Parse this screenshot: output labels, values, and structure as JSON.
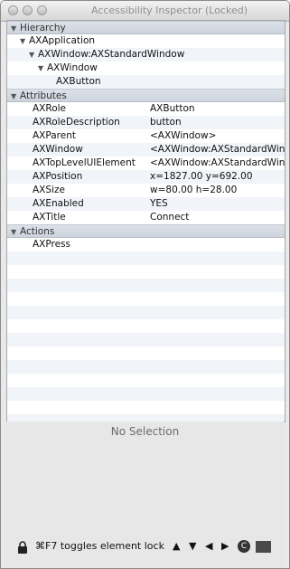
{
  "window": {
    "title": "Accessibility Inspector (Locked)"
  },
  "sections": {
    "hierarchy": "Hierarchy",
    "attributes": "Attributes",
    "actions": "Actions"
  },
  "hierarchy": [
    {
      "label": "AXApplication"
    },
    {
      "label": "AXWindow:AXStandardWindow"
    },
    {
      "label": "AXWindow"
    },
    {
      "label": "AXButton"
    }
  ],
  "attributes": [
    {
      "key": "AXRole",
      "value": "AXButton"
    },
    {
      "key": "AXRoleDescription",
      "value": "button"
    },
    {
      "key": "AXParent",
      "value": "<AXWindow>"
    },
    {
      "key": "AXWindow",
      "value": "<AXWindow:AXStandardWin"
    },
    {
      "key": "AXTopLevelUIElement",
      "value": "<AXWindow:AXStandardWin"
    },
    {
      "key": "AXPosition",
      "value": "x=1827.00 y=692.00"
    },
    {
      "key": "AXSize",
      "value": "w=80.00 h=28.00"
    },
    {
      "key": "AXEnabled",
      "value": "YES"
    },
    {
      "key": "AXTitle",
      "value": "Connect"
    }
  ],
  "actions": [
    {
      "label": "AXPress"
    }
  ],
  "detail": {
    "empty_text": "No Selection"
  },
  "footer": {
    "text": "⌘F7 toggles element lock",
    "up": "▲",
    "down": "▼",
    "left": "◀",
    "right": "▶",
    "refresh": "C"
  }
}
